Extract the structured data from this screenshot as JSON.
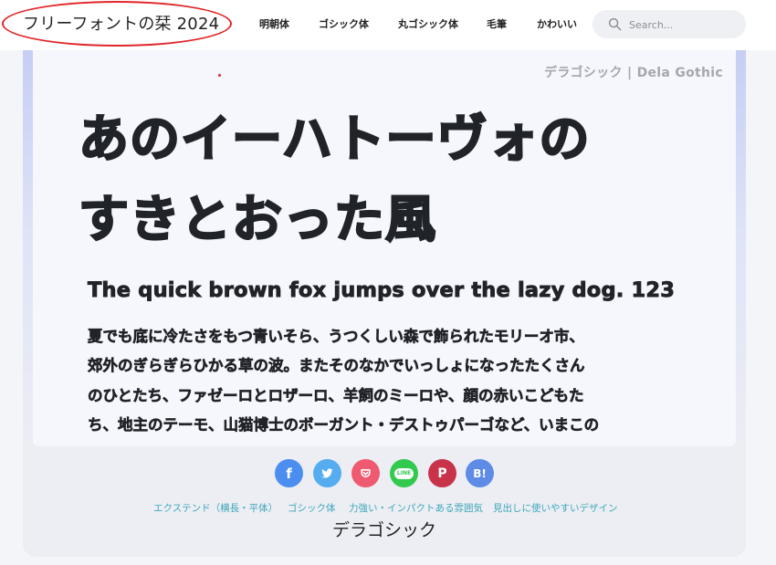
{
  "header": {
    "logo": "フリーフォントの栞 2024",
    "nav": [
      "明朝体",
      "ゴシック体",
      "丸ゴシック体",
      "毛筆",
      "かわいい"
    ],
    "search_placeholder": "Search..."
  },
  "preview": {
    "font_label": "デラゴシック | Dela Gothic",
    "big_lines": [
      "あのイーハトーヴォの",
      "すきとおった風"
    ],
    "pangram": "The quick brown fox jumps over the lazy dog. 123",
    "body_lines": [
      "夏でも底に冷たさをもつ青いそら、うつくしい森で飾られたモリーオ市、",
      "郊外のぎらぎらひかる草の波。またそのなかでいっしょになったたくさん",
      "のひとたち、ファゼーロとロザーロ、羊飼のミーロや、顔の赤いこどもた",
      "ち、地主のテーモ、山猫博士のボーガント・デストゥパーゴなど、いまこの"
    ]
  },
  "share": [
    {
      "name": "facebook",
      "icon": "facebook-icon",
      "glyph": "f",
      "color": "#4c8df0"
    },
    {
      "name": "twitter",
      "icon": "twitter-icon",
      "glyph": "",
      "color": "#55acee"
    },
    {
      "name": "pocket",
      "icon": "pocket-icon",
      "glyph": "",
      "color": "#ef5a70"
    },
    {
      "name": "line",
      "icon": "line-icon",
      "glyph": "LINE",
      "color": "#32c94f"
    },
    {
      "name": "pinterest",
      "icon": "pinterest-icon",
      "glyph": "P",
      "color": "#c8334a"
    },
    {
      "name": "hatena",
      "icon": "hatena-icon",
      "glyph": "B!",
      "color": "#5d8be6"
    }
  ],
  "tags": [
    "エクステンド（横長・平体）",
    "ゴシック体",
    "力強い・インパクトある雰囲気",
    "見出しに使いやすいデザイン"
  ],
  "font_title": "デラゴシック",
  "colors": {
    "accent_ring": "#e0262a",
    "tag": "#3fa7b8",
    "text": "#202327"
  }
}
